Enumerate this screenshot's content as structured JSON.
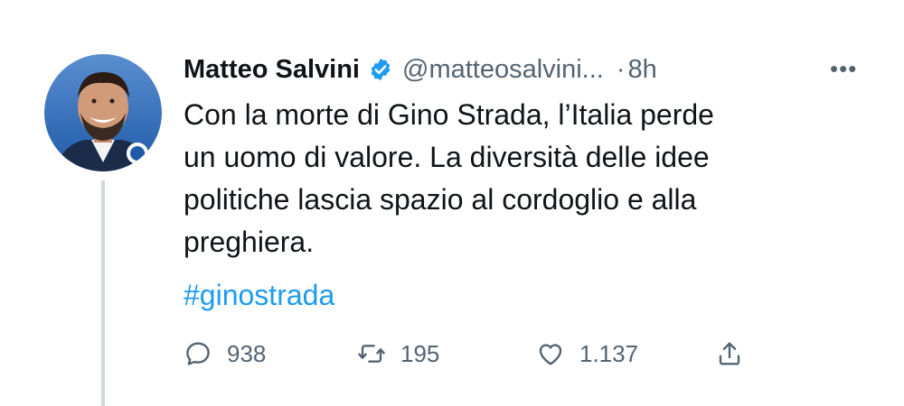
{
  "tweet": {
    "author": {
      "name": "Matteo Salvini",
      "handle": "@matteosalvini...",
      "verified": true,
      "avatar_icon": "profile-photo"
    },
    "separator": "·",
    "time": "8h",
    "more_label": "•••",
    "text_lines": [
      "Con la morte di Gino Strada, l’Italia perde",
      "un uomo di valore. La diversità delle idee",
      "politiche lascia spazio al cordoglio e alla",
      "preghiera."
    ],
    "hashtag": "#ginostrada",
    "actions": {
      "replies": "938",
      "retweets": "195",
      "likes": "1.137",
      "share_icon": "share-icon"
    }
  },
  "colors": {
    "text": "#0f1419",
    "secondary": "#536471",
    "accent": "#1d9bf0",
    "thread_line": "#cfd9de"
  }
}
